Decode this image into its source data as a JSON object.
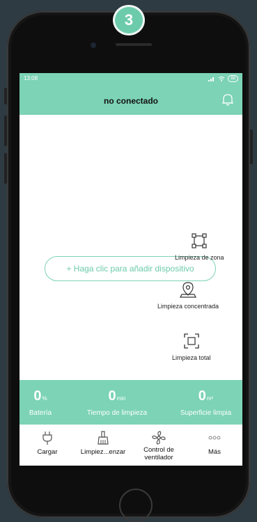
{
  "step_badge": "3",
  "status_bar": {
    "time": "13:08",
    "battery": "88"
  },
  "header": {
    "title": "no conectado"
  },
  "add_device_label": "+ Haga clic para añadir dispositivo",
  "modes": [
    {
      "label": "Limpieza de zona"
    },
    {
      "label": "Limpieza concentrada"
    },
    {
      "label": "Limpieza total"
    }
  ],
  "stats": [
    {
      "value": "0",
      "unit": "%",
      "label": "Batería"
    },
    {
      "value": "0",
      "unit": "min",
      "label": "Tiempo de limpieza"
    },
    {
      "value": "0",
      "unit": "m²",
      "label": "Superficie limpia"
    }
  ],
  "nav": [
    {
      "label": "Cargar",
      "icon": "plug-icon"
    },
    {
      "label": "Limpiez...enzar",
      "icon": "broom-icon"
    },
    {
      "label": "Control de ventilador",
      "icon": "fan-icon"
    },
    {
      "label": "Más",
      "icon": "more-icon"
    }
  ],
  "colors": {
    "accent": "#7cd3b5",
    "background": "#2f3b43",
    "badge": "#6ccbab"
  }
}
